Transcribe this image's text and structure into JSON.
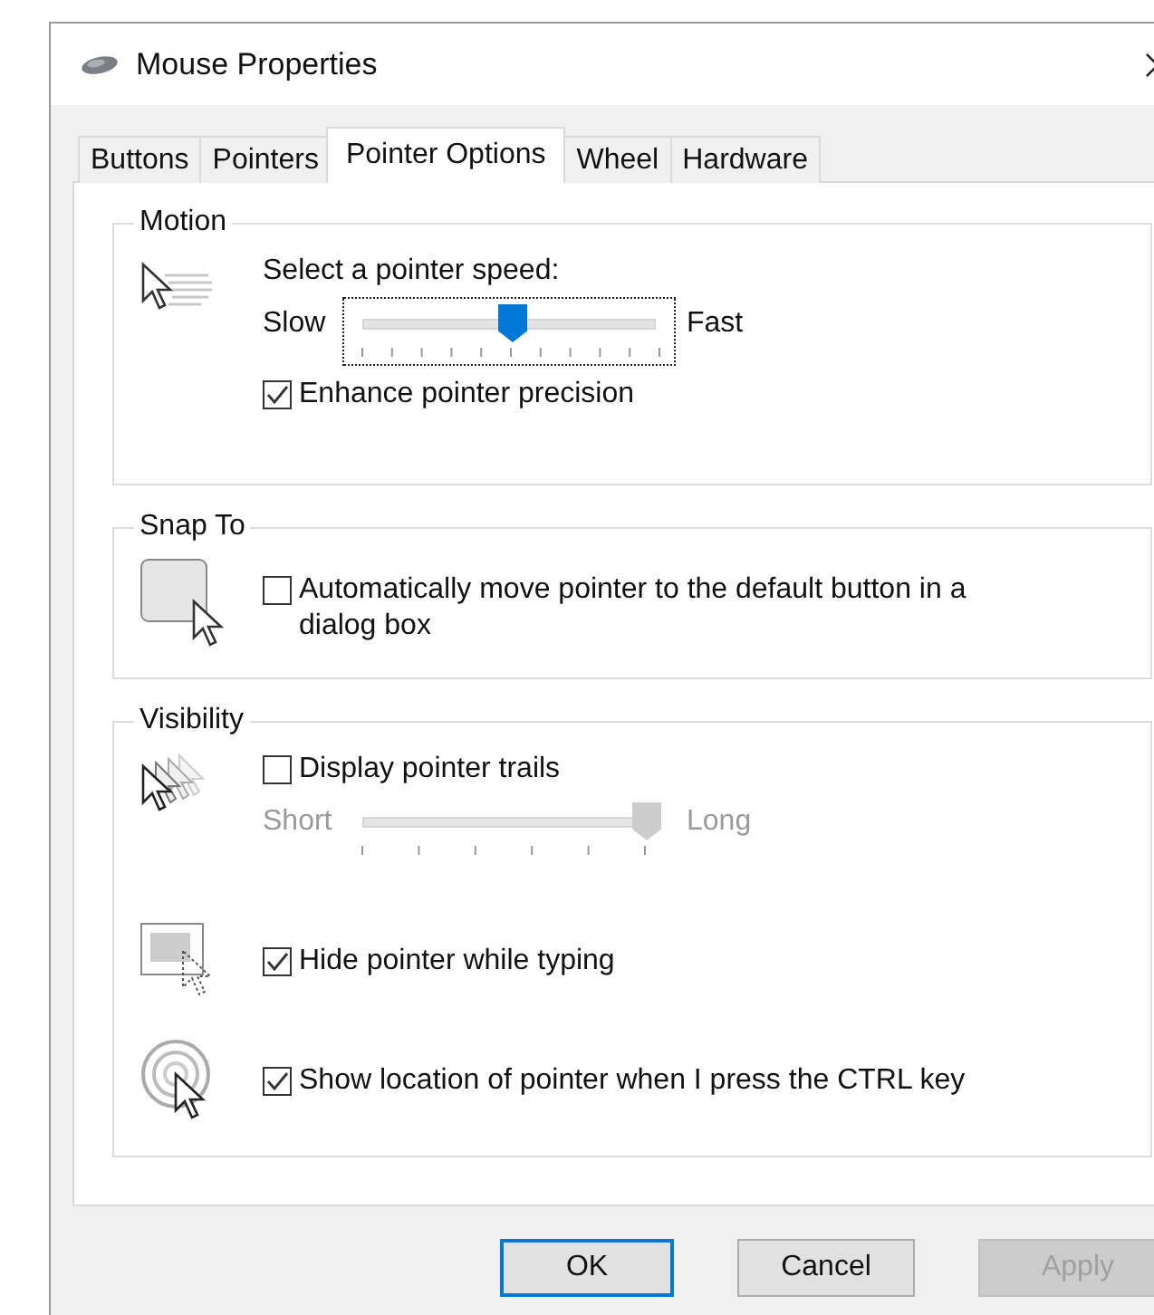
{
  "window": {
    "title": "Mouse Properties"
  },
  "tabs": [
    {
      "label": "Buttons",
      "selected": false
    },
    {
      "label": "Pointers",
      "selected": false
    },
    {
      "label": "Pointer Options",
      "selected": true
    },
    {
      "label": "Wheel",
      "selected": false
    },
    {
      "label": "Hardware",
      "selected": false
    }
  ],
  "motion": {
    "title": "Motion",
    "speed": {
      "label": "Select a pointer speed:",
      "min_label": "Slow",
      "max_label": "Fast",
      "level": 0.5,
      "focused": true,
      "disabled": false
    },
    "enhance": {
      "label": "Enhance pointer precision",
      "checked": true
    }
  },
  "snap_to": {
    "title": "Snap To",
    "checkbox": {
      "label": "Automatically move pointer to the default button in a dialog box",
      "checked": false
    }
  },
  "visibility": {
    "title": "Visibility",
    "trails": {
      "label": "Display pointer trails",
      "checked": false
    },
    "trail_length": {
      "min_label": "Short",
      "max_label": "Long",
      "level": 1,
      "focused": false,
      "disabled": true
    },
    "hide": {
      "label": "Hide pointer while typing",
      "checked": true
    },
    "show_location": {
      "label": "Show location of pointer when I press the CTRL key",
      "checked": true
    }
  },
  "buttons": [
    {
      "label": "OK",
      "default": true,
      "disabled": false
    },
    {
      "label": "Cancel",
      "default": false,
      "disabled": false
    },
    {
      "label": "Apply",
      "default": false,
      "disabled": true
    }
  ]
}
